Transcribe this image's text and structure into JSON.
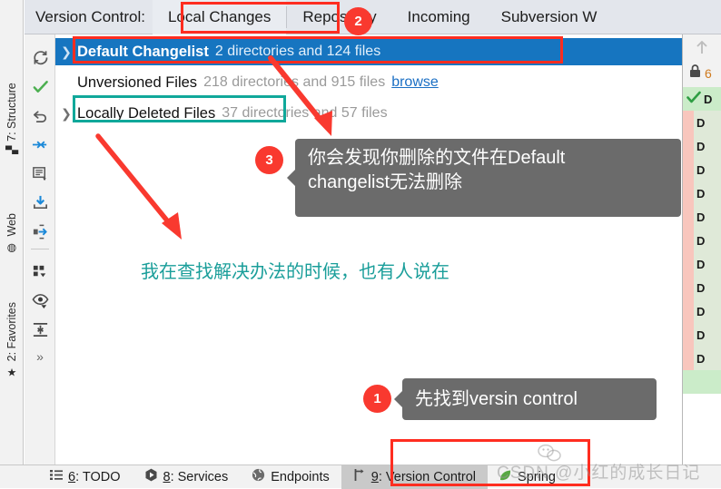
{
  "window": {
    "vc_label": "Version Control:",
    "tabs": [
      {
        "label": "Local Changes",
        "selected": true
      },
      {
        "label": "Repository",
        "selected": false
      },
      {
        "label": "Incoming",
        "selected": false
      },
      {
        "label": "Subversion W",
        "selected": false
      }
    ]
  },
  "left_tool_window_tabs": [
    {
      "mnemonic": "7",
      "label": "7: Structure",
      "icon": "structure-icon"
    },
    {
      "mnemonic": "",
      "label": "Web",
      "icon": "globe-icon"
    },
    {
      "mnemonic": "2",
      "label": "2: Favorites",
      "icon": "star-icon"
    }
  ],
  "panel_toolbar_icons": [
    "refresh-icon",
    "commit-checkmark-icon",
    "rollback-icon",
    "collapse-arrows-icon",
    "comment-icon",
    "update-download-icon",
    "shelve-merge-icon",
    "group-by-icon",
    "preview-eye-icon",
    "expand-collapse-icon",
    "overflow-chevrons-icon"
  ],
  "changelists": [
    {
      "name": "Default Changelist",
      "meta": "2 directories and 124 files",
      "selected": true,
      "expandable": true,
      "browse": ""
    },
    {
      "name": "Unversioned Files",
      "meta": "218 directories and 915 files",
      "selected": false,
      "expandable": false,
      "browse": "browse"
    },
    {
      "name": "Locally Deleted Files",
      "meta": "37 directories and 57 files",
      "selected": false,
      "expandable": true,
      "browse": ""
    }
  ],
  "right_pane": {
    "scroll_up_icon": "arrow-up-icon",
    "lock_icon": "lock-icon",
    "lock_count": "6",
    "rows": [
      {
        "marker": "check-icon",
        "text": "D",
        "band": "green"
      },
      {
        "marker": "",
        "text": "D",
        "band": "green"
      },
      {
        "marker": "",
        "text": "D",
        "band": "green"
      },
      {
        "marker": "",
        "text": "D",
        "band": "pink"
      },
      {
        "marker": "",
        "text": "D",
        "band": "green"
      },
      {
        "marker": "",
        "text": "D",
        "band": "green"
      },
      {
        "marker": "",
        "text": "D",
        "band": "green"
      },
      {
        "marker": "",
        "text": "D",
        "band": "green"
      },
      {
        "marker": "",
        "text": "D",
        "band": "green"
      },
      {
        "marker": "",
        "text": "D",
        "band": "green"
      },
      {
        "marker": "",
        "text": "D",
        "band": "green"
      },
      {
        "marker": "",
        "text": "D",
        "band": "green"
      }
    ]
  },
  "status_bar": [
    {
      "icon": "todo-list-icon",
      "mnemonic": "6",
      "rest": ": TODO",
      "active": false
    },
    {
      "icon": "services-play-icon",
      "mnemonic": "8",
      "rest": ": Services",
      "active": false
    },
    {
      "icon": "endpoints-globe-icon",
      "mnemonic": "",
      "rest": "Endpoints",
      "active": false
    },
    {
      "icon": "version-control-branch-icon",
      "mnemonic": "9",
      "rest": ": Version Control",
      "active": true
    },
    {
      "icon": "spring-leaf-icon",
      "mnemonic": "",
      "rest": "Spring",
      "active": false
    }
  ],
  "annotations": {
    "badge1": "1",
    "badge2": "2",
    "badge3": "3",
    "callout1": "先找到versin control",
    "callout3_line1": "你会发现你删除的文件在Default",
    "callout3_line2": "changelist无法删除",
    "teal_note": "我在查找解决办法的时候，也有人说在",
    "colors": {
      "red": "#ff2d20",
      "teal": "#10a89a",
      "badge": "#f9392f",
      "callout_bg": "#6b6b6b",
      "selection_blue": "#1675c0"
    }
  },
  "watermark": {
    "text": "CSDN @小红的成长日记",
    "icon": "wechat-icon"
  }
}
